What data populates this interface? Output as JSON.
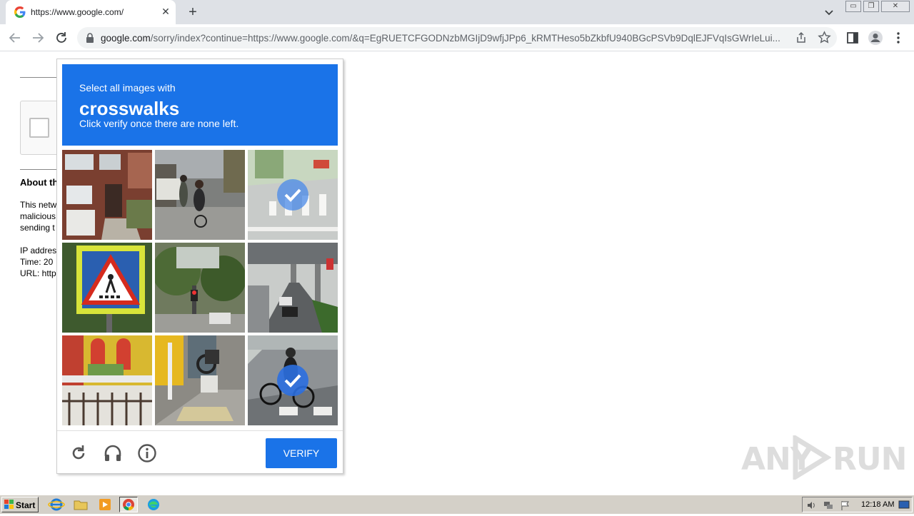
{
  "browser": {
    "tab": {
      "title": "https://www.google.com/",
      "favicon": "google-g-icon"
    },
    "url": {
      "host": "google.com",
      "rest": "/sorry/index?continue=https://www.google.com/&q=EgRUETCFGODNzbMGIjD9wfjJPp6_kRMTHeso5bZkbfU940BGcPSVb9DqlEJFVqIsGWrIeLui..."
    }
  },
  "page": {
    "about_heading": "About th",
    "lines": [
      "This netw",
      "malicious",
      "sending t",
      "",
      "IP addres",
      "Time: 20",
      "URL: http"
    ]
  },
  "challenge": {
    "instruction_small": "Select all images with",
    "instruction_target": "crosswalks",
    "instruction_hint": "Click verify once there are none left.",
    "tiles": [
      {
        "subject": "brick house with garage",
        "selected": false
      },
      {
        "subject": "street with pedestrians",
        "selected": false
      },
      {
        "subject": "road with crosswalk",
        "selected": true
      },
      {
        "subject": "pedestrian crossing sign",
        "selected": false
      },
      {
        "subject": "trees and traffic light",
        "selected": false
      },
      {
        "subject": "highway under overpass",
        "selected": false
      },
      {
        "subject": "colorful house facade",
        "selected": false
      },
      {
        "subject": "sidewalk with motorcycle",
        "selected": false
      },
      {
        "subject": "cyclist on crosswalk",
        "selected": true
      }
    ],
    "footer": {
      "reload_icon": "reload-icon",
      "audio_icon": "headphones-icon",
      "info_icon": "info-icon",
      "verify_label": "VERIFY"
    },
    "colors": {
      "accent": "#1a73e8"
    }
  },
  "watermark": {
    "left": "ANY",
    "right": "RUN"
  },
  "taskbar": {
    "start_label": "Start",
    "clock": "12:18 AM"
  }
}
